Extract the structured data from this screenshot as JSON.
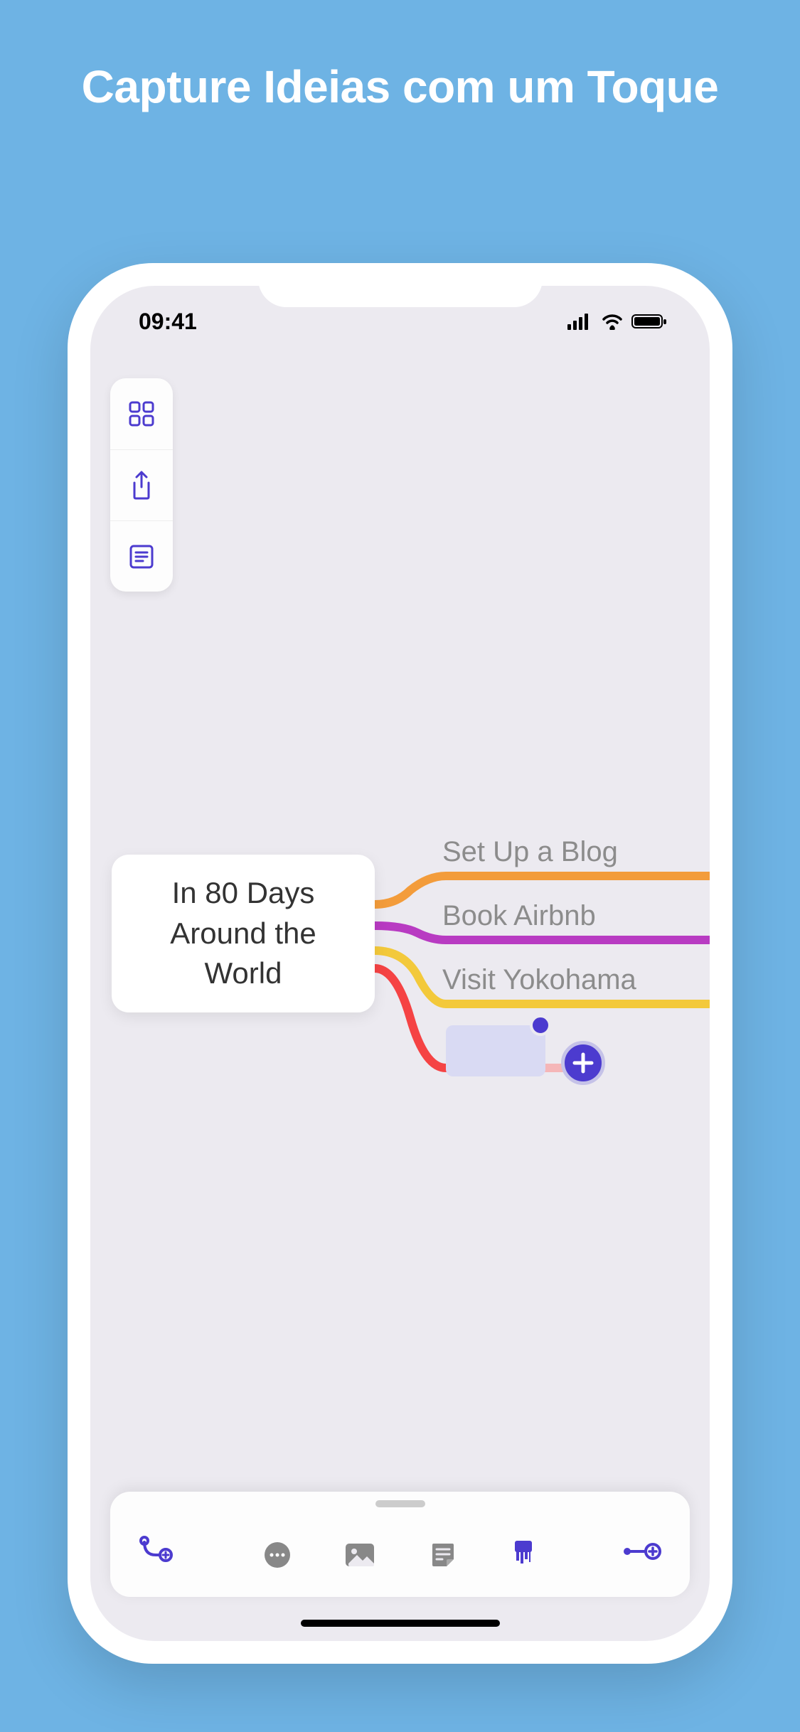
{
  "marketing": {
    "title": "Capture Ideias com um Toque"
  },
  "status": {
    "time": "09:41"
  },
  "mindmap": {
    "central_node": "In 80 Days Around the World",
    "children": [
      {
        "label": "Set Up a Blog",
        "color": "#F39C3B"
      },
      {
        "label": "Book Airbnb",
        "color": "#B83BC2"
      },
      {
        "label": "Visit Yokohama",
        "color": "#F3C93B"
      },
      {
        "label": "",
        "color": "#F54344"
      }
    ]
  },
  "colors": {
    "accent": "#4C3BCF",
    "background": "#6EB3E4",
    "canvas": "#ECEAF0"
  }
}
